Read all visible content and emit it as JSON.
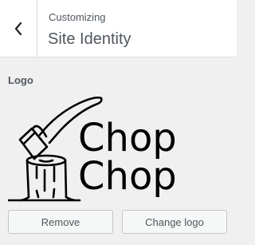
{
  "header": {
    "breadcrumb": "Customizing",
    "title": "Site Identity"
  },
  "logo_section": {
    "label": "Logo",
    "logo_text_line1": "Chop",
    "logo_text_line2": "Chop"
  },
  "buttons": {
    "remove": "Remove",
    "change": "Change logo"
  },
  "icons": {
    "back": "chevron-left-icon"
  },
  "colors": {
    "panel_bg": "#f0f0f1",
    "header_bg": "#ffffff",
    "text": "#50575e",
    "logo": "#000000"
  }
}
